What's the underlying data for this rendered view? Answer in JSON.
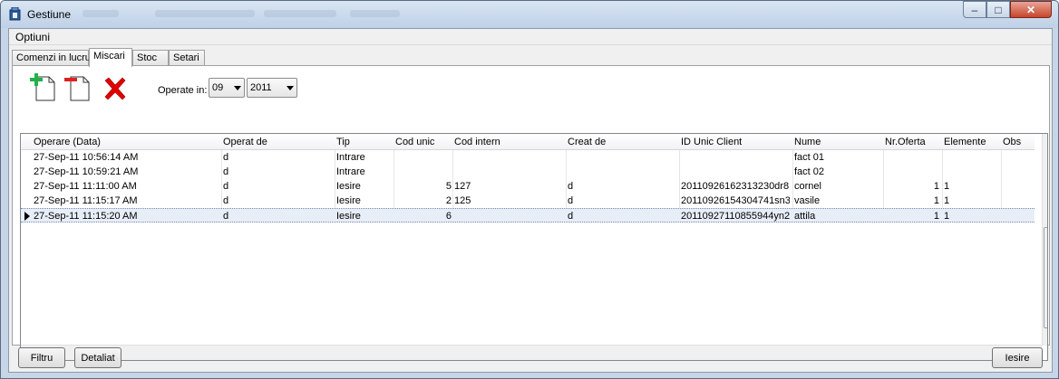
{
  "window": {
    "title": "Gestiune"
  },
  "menu": {
    "items": [
      "Optiuni"
    ]
  },
  "tabs": [
    "Comenzi in lucru",
    "Miscari",
    "Stoc",
    "Setari"
  ],
  "active_tab": "Miscari",
  "toolbar": {
    "icons": [
      "add-document-icon",
      "remove-document-icon",
      "delete-x-icon"
    ],
    "operate_label": "Operate in:",
    "month": "09",
    "year": "2011"
  },
  "grid": {
    "columns": [
      "Operare (Data)",
      "Operat de",
      "Tip",
      "Cod unic",
      "Cod intern",
      "Creat de",
      "ID Unic Client",
      "Nume",
      "Nr.Oferta",
      "Elemente",
      "Obs"
    ],
    "rows": [
      [
        "27-Sep-11 10:56:14 AM",
        "d",
        "Intrare",
        "",
        "",
        "",
        "",
        "fact 01",
        "",
        "",
        ""
      ],
      [
        "27-Sep-11 10:59:21 AM",
        "d",
        "Intrare",
        "",
        "",
        "",
        "",
        "fact 02",
        "",
        "",
        ""
      ],
      [
        "27-Sep-11 11:11:00 AM",
        "d",
        "Iesire",
        "5",
        "127",
        "d",
        "20110926162313230dr8",
        "cornel",
        "1",
        "1",
        ""
      ],
      [
        "27-Sep-11 11:15:17 AM",
        "d",
        "Iesire",
        "2",
        "125",
        "d",
        "20110926154304741sn3",
        "vasile",
        "1",
        "1",
        ""
      ],
      [
        "27-Sep-11 11:15:20 AM",
        "d",
        "Iesire",
        "6",
        "",
        "d",
        "20110927110855944yn2",
        "attila",
        "1",
        "1",
        ""
      ]
    ],
    "current_row": 4
  },
  "buttons": {
    "filter": "Filtru",
    "detailed": "Detaliat",
    "exit": "Iesire"
  },
  "colors": {
    "title_bg": "#c7d6e7",
    "close_btn": "#c7452b",
    "add_icon": "#22b14c",
    "remove_icon": "#e02020",
    "delete_icon": "#e00000"
  }
}
